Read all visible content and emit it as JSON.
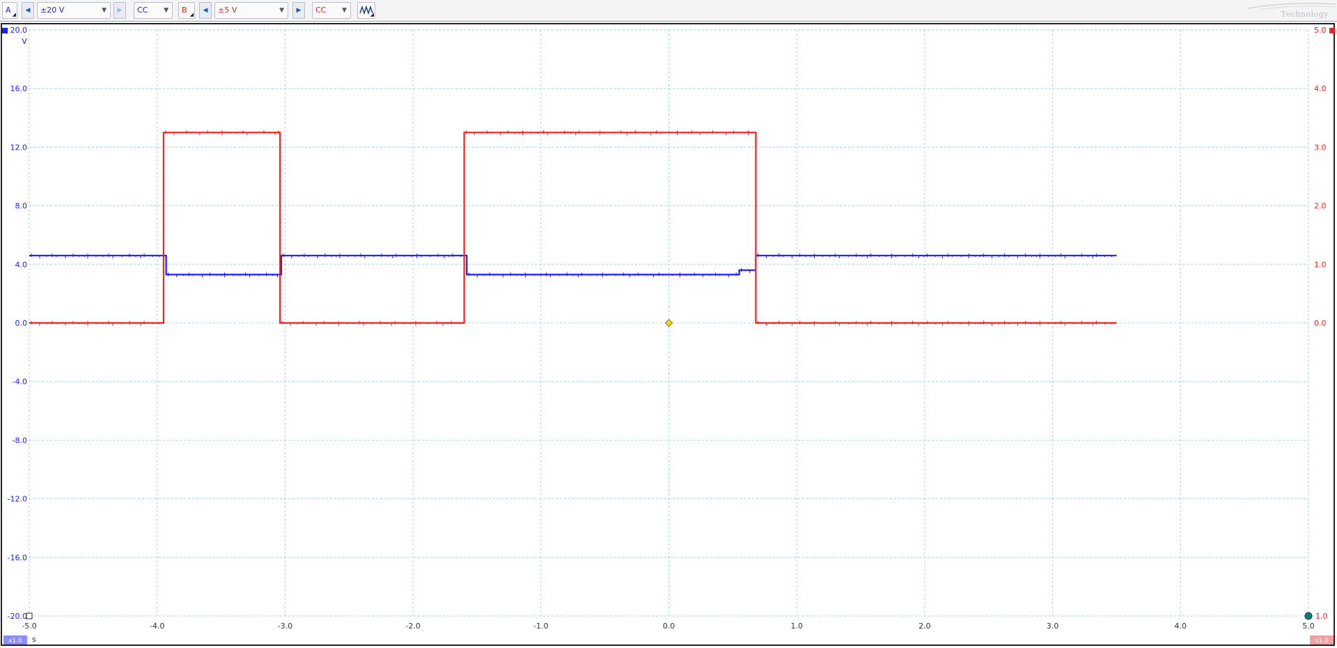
{
  "toolbar": {
    "channel_a": {
      "label": "A",
      "range": "±20 V",
      "coupling": "CC"
    },
    "channel_b": {
      "label": "B",
      "range": "±5 V",
      "coupling": "CC"
    },
    "prev_icon": "chevron-left-icon",
    "next_icon": "chevron-right-icon",
    "signal_icon": "waveform-icon",
    "logo_text": "Technology"
  },
  "colors": {
    "channel_a": "#1a1aff",
    "channel_b": "#ee2222",
    "grid": "#9fd3e0",
    "trigger": "#e8d820"
  },
  "chart_data": {
    "type": "line",
    "x_unit": "s",
    "xlim": [
      -5.0,
      5.0
    ],
    "x_ticks": [
      "-5.0",
      "-4.0",
      "-3.0",
      "-2.0",
      "-1.0",
      "0.0",
      "1.0",
      "2.0",
      "3.0",
      "4.0",
      "5.0"
    ],
    "left_axis": {
      "unit": "V",
      "ylim": [
        -20,
        20
      ],
      "ticks": [
        "20.0",
        "16.0",
        "12.0",
        "8.0",
        "4.0",
        "0.0",
        "-4.0",
        "-8.0",
        "-12.0",
        "-16.0",
        "-20.0"
      ]
    },
    "right_axis": {
      "unit": "V",
      "ylim": [
        -5,
        5
      ],
      "ticks": [
        "5.0",
        "4.0",
        "3.0",
        "2.0",
        "1.0",
        "0.0"
      ],
      "tick_values": [
        5,
        4,
        3,
        2,
        1,
        0
      ]
    },
    "bottom_left_badge": "x1.0",
    "bottom_right_badge": "x1.0",
    "bottom_right_label": "1.0",
    "series": [
      {
        "axis": "left",
        "color": "#1a1aff",
        "x": [
          -5.0,
          -3.93,
          -3.93,
          -3.03,
          -3.03,
          -1.58,
          -1.58,
          0.55,
          0.55,
          0.68,
          0.68,
          3.5
        ],
        "y": [
          4.6,
          4.6,
          3.3,
          3.3,
          4.6,
          4.6,
          3.3,
          3.3,
          3.6,
          3.6,
          4.6,
          4.6
        ]
      },
      {
        "axis": "right",
        "color": "#ee2222",
        "x": [
          -5.0,
          -3.95,
          -3.95,
          -3.04,
          -3.04,
          -1.6,
          -1.6,
          0.68,
          0.68,
          3.5
        ],
        "y": [
          0.0,
          0.0,
          3.25,
          3.25,
          0.0,
          0.0,
          3.25,
          3.25,
          0.0,
          0.0
        ]
      }
    ],
    "trigger_marker": {
      "x": 0.0,
      "y": 0.0
    }
  }
}
